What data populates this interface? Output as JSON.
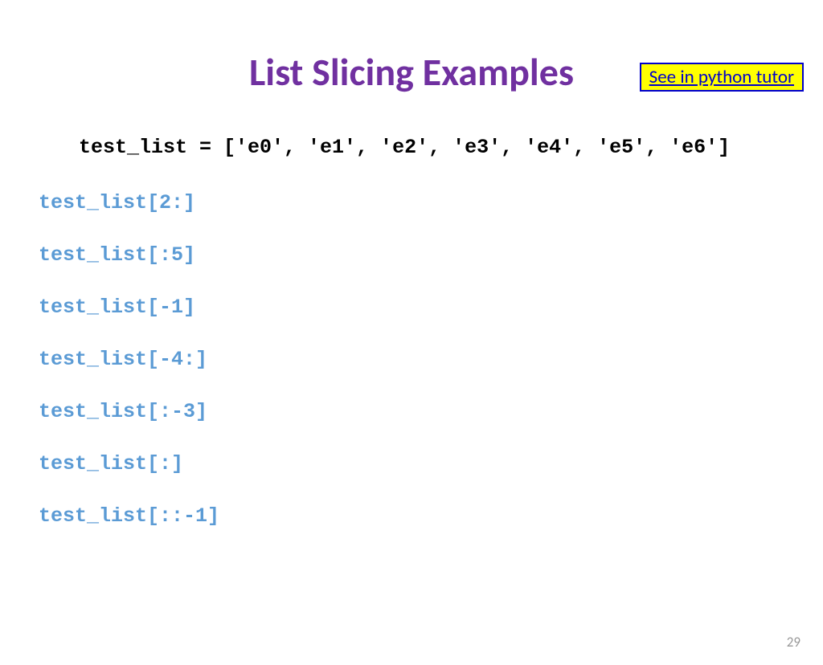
{
  "link": {
    "label": "See in python tutor"
  },
  "title": "List Slicing Examples",
  "declaration": "test_list = ['e0', 'e1', 'e2', 'e3', 'e4', 'e5', 'e6']",
  "examples": [
    "test_list[2:]",
    "test_list[:5]",
    "test_list[-1]",
    "test_list[-4:]",
    "test_list[:-3]",
    "test_list[:]",
    "test_list[::-1]"
  ],
  "pageNumber": "29"
}
